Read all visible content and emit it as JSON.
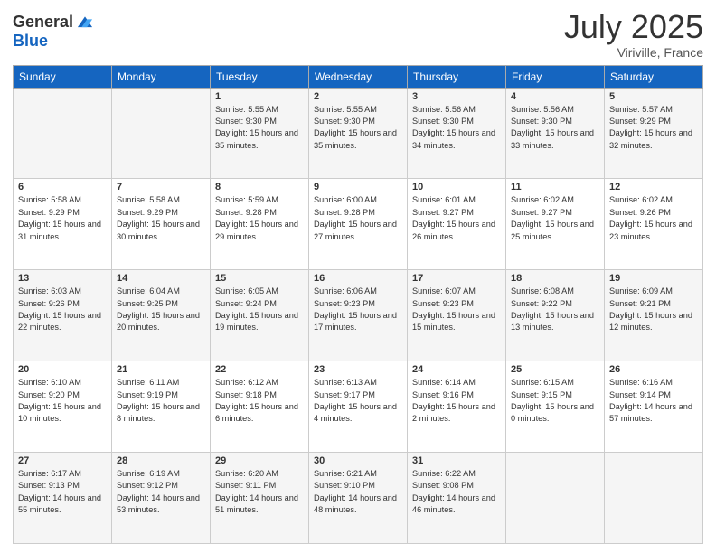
{
  "header": {
    "logo_line1": "General",
    "logo_line2": "Blue",
    "month": "July 2025",
    "location": "Viriville, France"
  },
  "weekdays": [
    "Sunday",
    "Monday",
    "Tuesday",
    "Wednesday",
    "Thursday",
    "Friday",
    "Saturday"
  ],
  "weeks": [
    [
      {
        "day": "",
        "sunrise": "",
        "sunset": "",
        "daylight": ""
      },
      {
        "day": "",
        "sunrise": "",
        "sunset": "",
        "daylight": ""
      },
      {
        "day": "1",
        "sunrise": "Sunrise: 5:55 AM",
        "sunset": "Sunset: 9:30 PM",
        "daylight": "Daylight: 15 hours and 35 minutes."
      },
      {
        "day": "2",
        "sunrise": "Sunrise: 5:55 AM",
        "sunset": "Sunset: 9:30 PM",
        "daylight": "Daylight: 15 hours and 35 minutes."
      },
      {
        "day": "3",
        "sunrise": "Sunrise: 5:56 AM",
        "sunset": "Sunset: 9:30 PM",
        "daylight": "Daylight: 15 hours and 34 minutes."
      },
      {
        "day": "4",
        "sunrise": "Sunrise: 5:56 AM",
        "sunset": "Sunset: 9:30 PM",
        "daylight": "Daylight: 15 hours and 33 minutes."
      },
      {
        "day": "5",
        "sunrise": "Sunrise: 5:57 AM",
        "sunset": "Sunset: 9:29 PM",
        "daylight": "Daylight: 15 hours and 32 minutes."
      }
    ],
    [
      {
        "day": "6",
        "sunrise": "Sunrise: 5:58 AM",
        "sunset": "Sunset: 9:29 PM",
        "daylight": "Daylight: 15 hours and 31 minutes."
      },
      {
        "day": "7",
        "sunrise": "Sunrise: 5:58 AM",
        "sunset": "Sunset: 9:29 PM",
        "daylight": "Daylight: 15 hours and 30 minutes."
      },
      {
        "day": "8",
        "sunrise": "Sunrise: 5:59 AM",
        "sunset": "Sunset: 9:28 PM",
        "daylight": "Daylight: 15 hours and 29 minutes."
      },
      {
        "day": "9",
        "sunrise": "Sunrise: 6:00 AM",
        "sunset": "Sunset: 9:28 PM",
        "daylight": "Daylight: 15 hours and 27 minutes."
      },
      {
        "day": "10",
        "sunrise": "Sunrise: 6:01 AM",
        "sunset": "Sunset: 9:27 PM",
        "daylight": "Daylight: 15 hours and 26 minutes."
      },
      {
        "day": "11",
        "sunrise": "Sunrise: 6:02 AM",
        "sunset": "Sunset: 9:27 PM",
        "daylight": "Daylight: 15 hours and 25 minutes."
      },
      {
        "day": "12",
        "sunrise": "Sunrise: 6:02 AM",
        "sunset": "Sunset: 9:26 PM",
        "daylight": "Daylight: 15 hours and 23 minutes."
      }
    ],
    [
      {
        "day": "13",
        "sunrise": "Sunrise: 6:03 AM",
        "sunset": "Sunset: 9:26 PM",
        "daylight": "Daylight: 15 hours and 22 minutes."
      },
      {
        "day": "14",
        "sunrise": "Sunrise: 6:04 AM",
        "sunset": "Sunset: 9:25 PM",
        "daylight": "Daylight: 15 hours and 20 minutes."
      },
      {
        "day": "15",
        "sunrise": "Sunrise: 6:05 AM",
        "sunset": "Sunset: 9:24 PM",
        "daylight": "Daylight: 15 hours and 19 minutes."
      },
      {
        "day": "16",
        "sunrise": "Sunrise: 6:06 AM",
        "sunset": "Sunset: 9:23 PM",
        "daylight": "Daylight: 15 hours and 17 minutes."
      },
      {
        "day": "17",
        "sunrise": "Sunrise: 6:07 AM",
        "sunset": "Sunset: 9:23 PM",
        "daylight": "Daylight: 15 hours and 15 minutes."
      },
      {
        "day": "18",
        "sunrise": "Sunrise: 6:08 AM",
        "sunset": "Sunset: 9:22 PM",
        "daylight": "Daylight: 15 hours and 13 minutes."
      },
      {
        "day": "19",
        "sunrise": "Sunrise: 6:09 AM",
        "sunset": "Sunset: 9:21 PM",
        "daylight": "Daylight: 15 hours and 12 minutes."
      }
    ],
    [
      {
        "day": "20",
        "sunrise": "Sunrise: 6:10 AM",
        "sunset": "Sunset: 9:20 PM",
        "daylight": "Daylight: 15 hours and 10 minutes."
      },
      {
        "day": "21",
        "sunrise": "Sunrise: 6:11 AM",
        "sunset": "Sunset: 9:19 PM",
        "daylight": "Daylight: 15 hours and 8 minutes."
      },
      {
        "day": "22",
        "sunrise": "Sunrise: 6:12 AM",
        "sunset": "Sunset: 9:18 PM",
        "daylight": "Daylight: 15 hours and 6 minutes."
      },
      {
        "day": "23",
        "sunrise": "Sunrise: 6:13 AM",
        "sunset": "Sunset: 9:17 PM",
        "daylight": "Daylight: 15 hours and 4 minutes."
      },
      {
        "day": "24",
        "sunrise": "Sunrise: 6:14 AM",
        "sunset": "Sunset: 9:16 PM",
        "daylight": "Daylight: 15 hours and 2 minutes."
      },
      {
        "day": "25",
        "sunrise": "Sunrise: 6:15 AM",
        "sunset": "Sunset: 9:15 PM",
        "daylight": "Daylight: 15 hours and 0 minutes."
      },
      {
        "day": "26",
        "sunrise": "Sunrise: 6:16 AM",
        "sunset": "Sunset: 9:14 PM",
        "daylight": "Daylight: 14 hours and 57 minutes."
      }
    ],
    [
      {
        "day": "27",
        "sunrise": "Sunrise: 6:17 AM",
        "sunset": "Sunset: 9:13 PM",
        "daylight": "Daylight: 14 hours and 55 minutes."
      },
      {
        "day": "28",
        "sunrise": "Sunrise: 6:19 AM",
        "sunset": "Sunset: 9:12 PM",
        "daylight": "Daylight: 14 hours and 53 minutes."
      },
      {
        "day": "29",
        "sunrise": "Sunrise: 6:20 AM",
        "sunset": "Sunset: 9:11 PM",
        "daylight": "Daylight: 14 hours and 51 minutes."
      },
      {
        "day": "30",
        "sunrise": "Sunrise: 6:21 AM",
        "sunset": "Sunset: 9:10 PM",
        "daylight": "Daylight: 14 hours and 48 minutes."
      },
      {
        "day": "31",
        "sunrise": "Sunrise: 6:22 AM",
        "sunset": "Sunset: 9:08 PM",
        "daylight": "Daylight: 14 hours and 46 minutes."
      },
      {
        "day": "",
        "sunrise": "",
        "sunset": "",
        "daylight": ""
      },
      {
        "day": "",
        "sunrise": "",
        "sunset": "",
        "daylight": ""
      }
    ]
  ]
}
